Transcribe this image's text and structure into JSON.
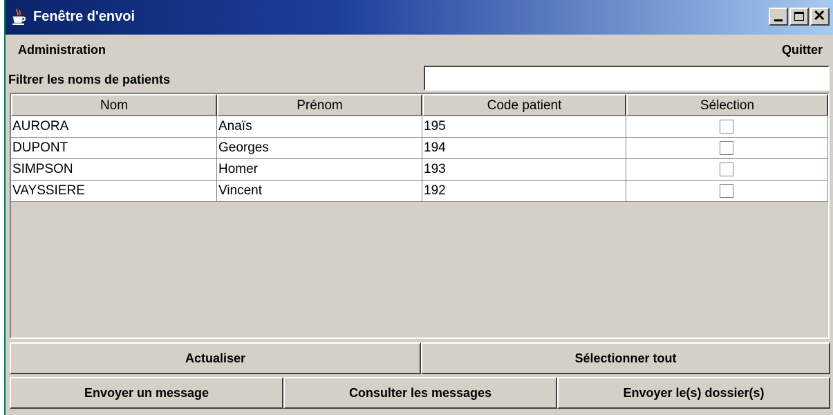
{
  "window": {
    "title": "Fenêtre d'envoi",
    "titlebar_gradient": [
      "#0a246a",
      "#a6caf0"
    ]
  },
  "menubar": {
    "administration": "Administration",
    "quit": "Quitter"
  },
  "filter": {
    "label": "Filtrer les noms de patients",
    "value": ""
  },
  "table": {
    "headers": {
      "nom": "Nom",
      "prenom": "Prénom",
      "code": "Code patient",
      "selection": "Sélection"
    },
    "rows": [
      {
        "nom": "AURORA",
        "prenom": "Anaïs",
        "code": "195",
        "selected": false
      },
      {
        "nom": "DUPONT",
        "prenom": "Georges",
        "code": "194",
        "selected": false
      },
      {
        "nom": "SIMPSON",
        "prenom": "Homer",
        "code": "193",
        "selected": false
      },
      {
        "nom": "VAYSSIERE",
        "prenom": "Vincent",
        "code": "192",
        "selected": false
      }
    ]
  },
  "buttons": {
    "refresh": "Actualiser",
    "select_all": "Sélectionner tout",
    "send_message": "Envoyer un message",
    "read_messages": "Consulter les messages",
    "send_files": "Envoyer le(s) dossier(s)"
  },
  "icons": {
    "app": "java-coffee-cup-icon",
    "minimize": "minimize-icon",
    "maximize": "maximize-icon",
    "close": "close-icon"
  }
}
